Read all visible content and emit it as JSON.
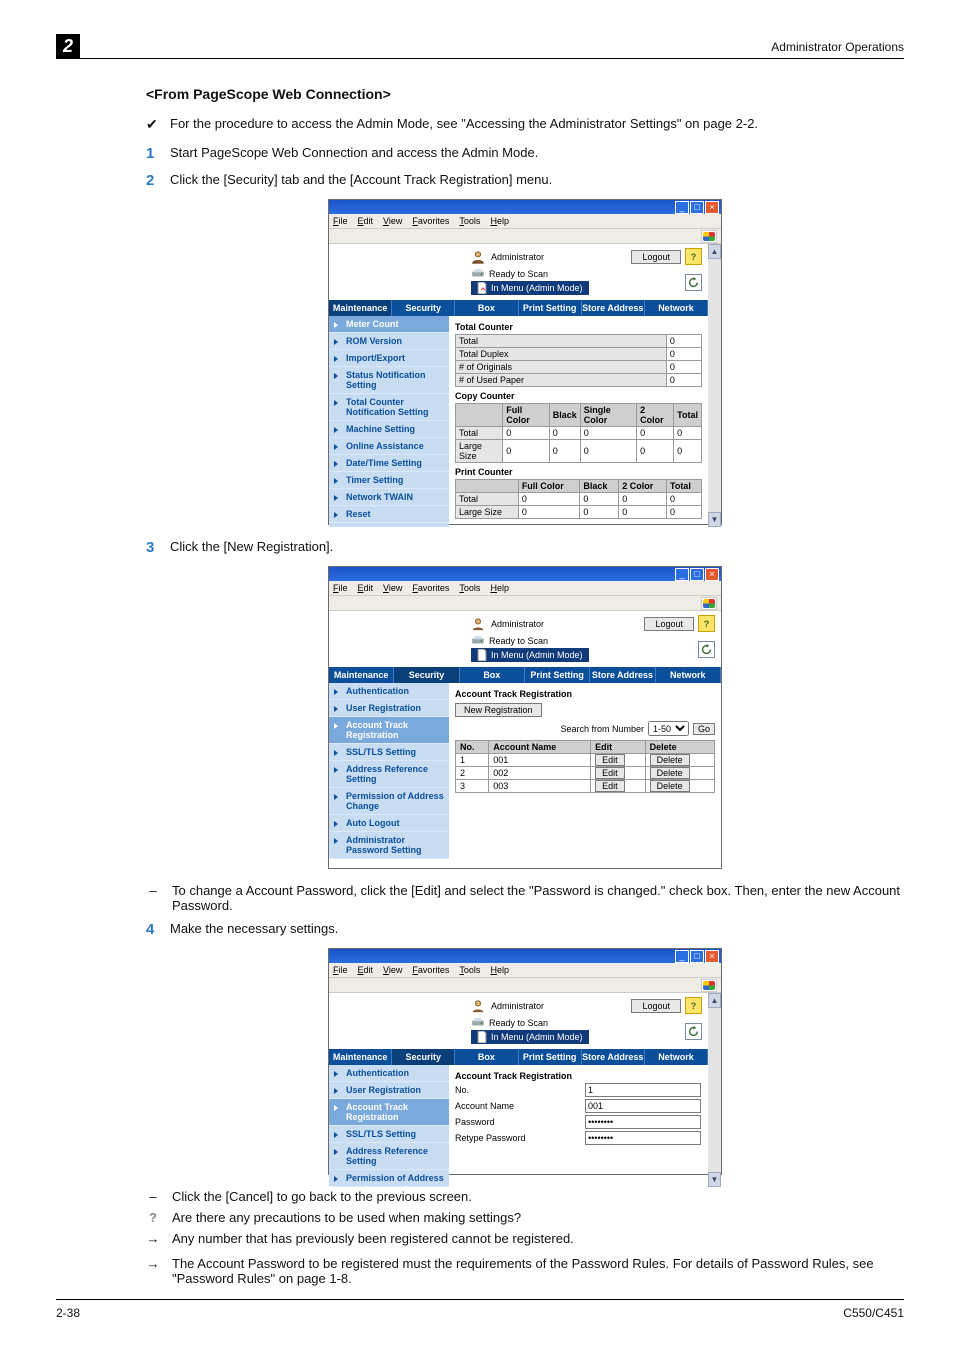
{
  "header": {
    "chapter": "2",
    "title": "Administrator Operations"
  },
  "section": {
    "heading": "<From PageScope Web Connection>",
    "note": "For the procedure to access the Admin Mode, see \"Accessing the Administrator Settings\" on page 2-2."
  },
  "steps": [
    {
      "num": "1",
      "text": "Start PageScope Web Connection and access the Admin Mode."
    },
    {
      "num": "2",
      "text": "Click the [Security] tab and the [Account Track Registration] menu."
    },
    {
      "num": "3",
      "text": "Click the [New Registration]."
    },
    {
      "num": "4",
      "text": "Make the necessary settings."
    }
  ],
  "substeps": [
    "To change a Account Password, click the [Edit] and select the \"Password is changed.\" check box. Then, enter the new Account Password.",
    "Click the [Cancel] to go back to the previous screen.",
    "Are there any precautions to be used when making settings?",
    "Any number that has previously been registered cannot be registered.",
    "The Account Password to be registered must the requirements of the Password Rules. For details of Password Rules, see \"Password Rules\" on page 1-8."
  ],
  "browser": {
    "menu": [
      "File",
      "Edit",
      "View",
      "Favorites",
      "Tools",
      "Help"
    ],
    "admin": "Administrator",
    "logout": "Logout",
    "ready": "Ready to Scan",
    "menustat": "In Menu (Admin Mode)"
  },
  "tabs": [
    "Maintenance",
    "Security",
    "Box",
    "Print Setting",
    "Store Address",
    "Network"
  ],
  "shot1": {
    "side": [
      "Meter Count",
      "ROM Version",
      "Import/Export",
      "Status Notification Setting",
      "Total Counter Notification Setting",
      "Machine Setting",
      "Online Assistance",
      "Date/Time Setting",
      "Timer Setting",
      "Network TWAIN",
      "Reset"
    ],
    "h1": "Total Counter",
    "total": {
      "rows": [
        [
          "Total",
          "0"
        ],
        [
          "Total Duplex",
          "0"
        ],
        [
          "# of Originals",
          "0"
        ],
        [
          "# of Used Paper",
          "0"
        ]
      ]
    },
    "h2": "Copy Counter",
    "copy": {
      "cols": [
        "Full Color",
        "Black",
        "Single Color",
        "2 Color",
        "Total"
      ],
      "rows": [
        [
          "Total",
          "0",
          "0",
          "0",
          "0",
          "0"
        ],
        [
          "Large Size",
          "0",
          "0",
          "0",
          "0",
          "0"
        ]
      ]
    },
    "h3": "Print Counter",
    "print": {
      "cols": [
        "Full Color",
        "Black",
        "2 Color",
        "Total"
      ],
      "rows": [
        [
          "Total",
          "0",
          "0",
          "0",
          "0"
        ],
        [
          "Large Size",
          "0",
          "0",
          "0",
          "0"
        ]
      ]
    }
  },
  "shot2": {
    "side": [
      "Authentication",
      "User Registration",
      "Account Track Registration",
      "SSL/TLS Setting",
      "Address Reference Setting",
      "Permission of Address Change",
      "Auto Logout",
      "Administrator Password Setting"
    ],
    "heading": "Account Track Registration",
    "newreg": "New Registration",
    "search": "Search from Number",
    "range": "1-50",
    "go": "Go",
    "cols": [
      "No.",
      "Account Name",
      "Edit",
      "Delete"
    ],
    "rows": [
      [
        "1",
        "001"
      ],
      [
        "2",
        "002"
      ],
      [
        "3",
        "003"
      ]
    ],
    "edit": "Edit",
    "delete": "Delete"
  },
  "shot3": {
    "side_extra": "Permission of Address",
    "labels": [
      "No.",
      "Account Name",
      "Password",
      "Retype Password"
    ],
    "values": [
      "1",
      "001",
      "********",
      "********"
    ]
  },
  "footer": {
    "left": "2-38",
    "right": "C550/C451"
  }
}
